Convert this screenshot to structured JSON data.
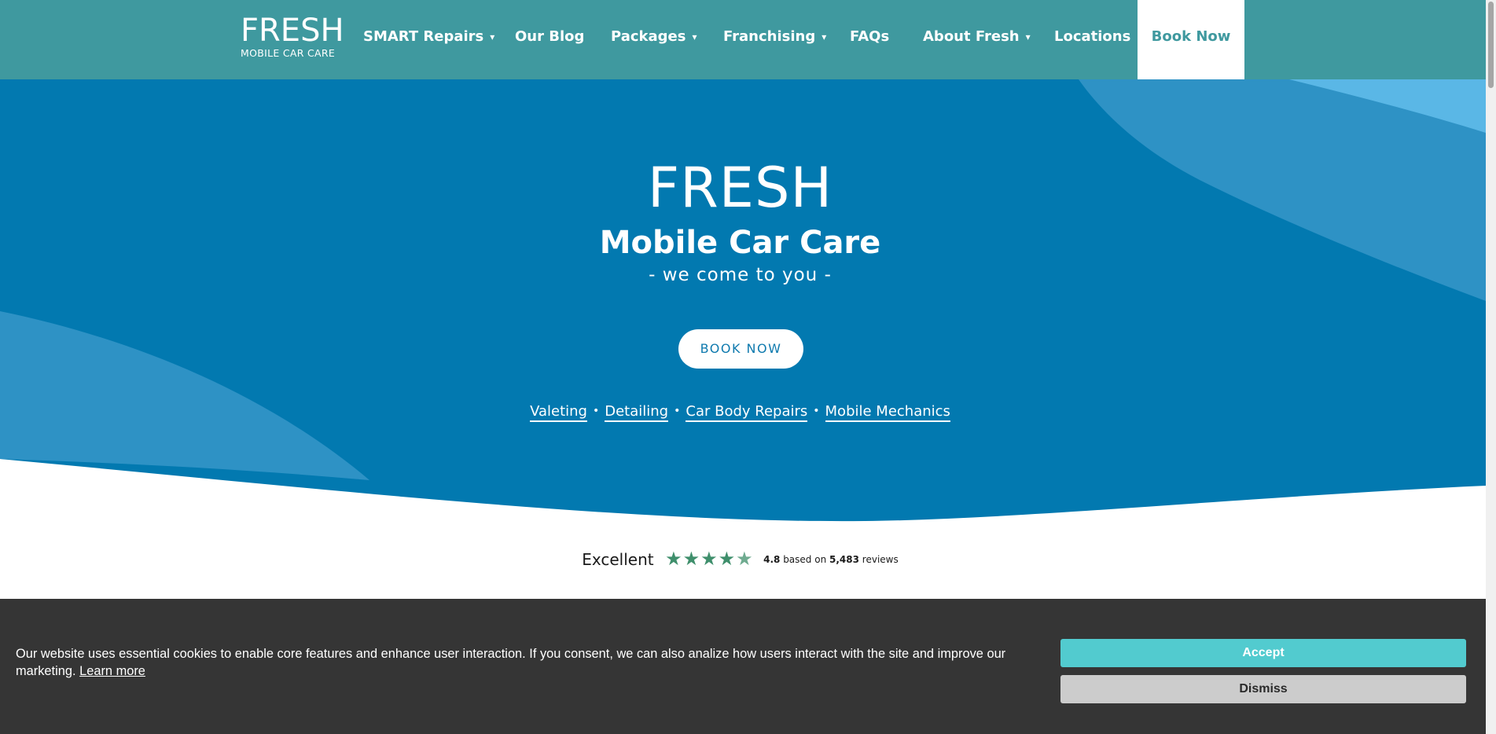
{
  "header": {
    "logo_main": "FRESH",
    "logo_sub": "MOBILE CAR CARE",
    "nav": [
      {
        "label": "SMART Repairs",
        "has_dropdown": true
      },
      {
        "label": "Our Blog",
        "has_dropdown": false
      },
      {
        "label": "Packages",
        "has_dropdown": true
      },
      {
        "label": "Franchising",
        "has_dropdown": true
      },
      {
        "label": "FAQs",
        "has_dropdown": false
      },
      {
        "label": "About Fresh",
        "has_dropdown": true
      },
      {
        "label": "Locations",
        "has_dropdown": false
      }
    ],
    "book_now": "Book Now",
    "caret_icon": "chevron-down-icon",
    "color": "#3f999f"
  },
  "hero": {
    "title": "FRESH",
    "subtitle": "Mobile Car Care",
    "tagline": "- we come to you -",
    "button": "BOOK NOW",
    "services": [
      "Valeting",
      "Detailing",
      "Car Body Repairs",
      "Mobile Mechanics"
    ],
    "colors": {
      "primary": "#0279b0",
      "light": "#2e92c5",
      "lighter": "#5ab7e6"
    }
  },
  "reviews": {
    "rating_word": "Excellent",
    "score": "4.8",
    "based_on": "based on",
    "count": "5,483",
    "reviews_word": "reviews",
    "stars_value": 4.8,
    "stars_max": 5,
    "star_icon": "star-icon"
  },
  "cookie": {
    "message": "Our website uses essential cookies to enable core features and enhance user interaction. If you consent, we can also analize how users interact with the site and improve our marketing.",
    "learn_more": "Learn more",
    "accept": "Accept",
    "dismiss": "Dismiss"
  }
}
